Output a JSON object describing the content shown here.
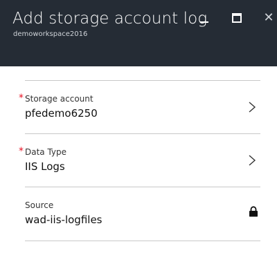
{
  "blade": {
    "title": "Add storage account log",
    "subtitle": "demoworkspace2016",
    "minimize_glyph": "—",
    "close_glyph": "✕"
  },
  "fields": {
    "storage_account": {
      "required_marker": "*",
      "label": "Storage account",
      "value": "pfedemo6250",
      "icon": "chevron-right-icon"
    },
    "data_type": {
      "required_marker": "*",
      "label": "Data Type",
      "value": "IIS Logs",
      "icon": "chevron-right-icon"
    },
    "source": {
      "label": "Source",
      "value": "wad-iis-logfiles",
      "icon": "lock-icon"
    }
  },
  "colors": {
    "header_bg": "#252c35",
    "required": "#e81123",
    "separator": "#c8c8c8"
  }
}
